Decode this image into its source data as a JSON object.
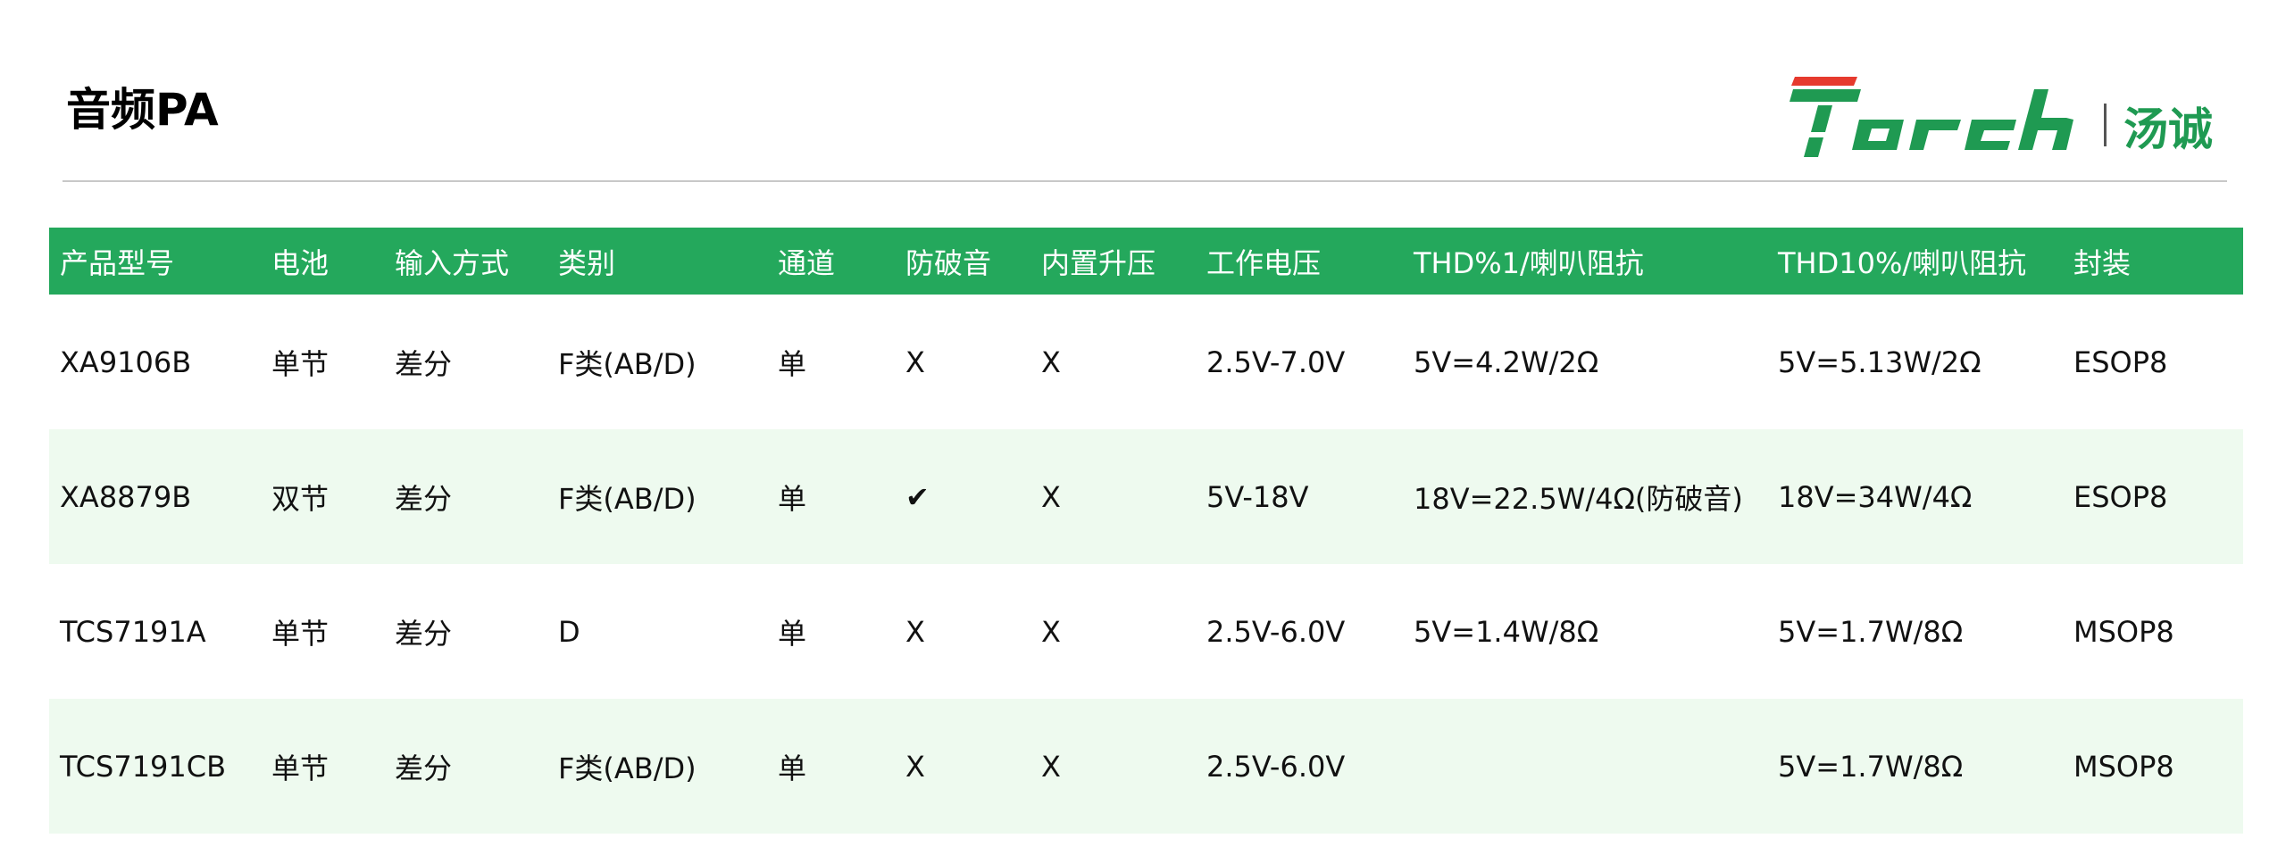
{
  "header": {
    "title": "音频PA",
    "logo": {
      "brand_text": "Torch",
      "cn_text": "汤诚",
      "colors": {
        "green": "#1f9a52",
        "red": "#e63a2e",
        "divider": "#555555"
      }
    }
  },
  "colors": {
    "header_bg": "#24a85c",
    "header_text": "#ffffff",
    "row_alt_bg": "#eefaef",
    "divider": "#c8c8c8"
  },
  "table": {
    "columns": [
      "产品型号",
      "电池",
      "输入方式",
      "类别",
      "通道",
      "防破音",
      "内置升压",
      "工作电压",
      "THD%1/喇叭阻抗",
      "THD10%/喇叭阻抗",
      "封装"
    ],
    "rows": [
      [
        "XA9106B",
        "单节",
        "差分",
        "F类(AB/D)",
        "单",
        "X",
        "X",
        "2.5V-7.0V",
        "5V=4.2W/2Ω",
        "5V=5.13W/2Ω",
        "ESOP8"
      ],
      [
        "XA8879B",
        "双节",
        "差分",
        "F类(AB/D)",
        "单",
        "✔",
        "X",
        "5V-18V",
        "18V=22.5W/4Ω(防破音)",
        "18V=34W/4Ω",
        "ESOP8"
      ],
      [
        "TCS7191A",
        "单节",
        "差分",
        "D",
        "单",
        "X",
        "X",
        "2.5V-6.0V",
        "5V=1.4W/8Ω",
        "5V=1.7W/8Ω",
        "MSOP8"
      ],
      [
        "TCS7191CB",
        "单节",
        "差分",
        "F类(AB/D)",
        "单",
        "X",
        "X",
        "2.5V-6.0V",
        "",
        "5V=1.7W/8Ω",
        "MSOP8"
      ]
    ]
  }
}
